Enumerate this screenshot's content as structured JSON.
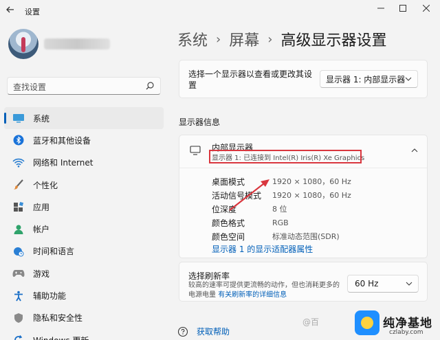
{
  "window": {
    "title": "设置"
  },
  "profile": {},
  "search": {
    "placeholder": "查找设置"
  },
  "sidebar": {
    "items": [
      {
        "label": "系统",
        "icon": "monitor-icon",
        "selected": true
      },
      {
        "label": "蓝牙和其他设备",
        "icon": "bluetooth-icon"
      },
      {
        "label": "网络和 Internet",
        "icon": "wifi-icon"
      },
      {
        "label": "个性化",
        "icon": "brush-icon"
      },
      {
        "label": "应用",
        "icon": "apps-icon"
      },
      {
        "label": "帐户",
        "icon": "person-icon"
      },
      {
        "label": "时间和语言",
        "icon": "globe-clock-icon"
      },
      {
        "label": "游戏",
        "icon": "gamepad-icon"
      },
      {
        "label": "辅助功能",
        "icon": "accessibility-icon"
      },
      {
        "label": "隐私和安全性",
        "icon": "shield-icon"
      },
      {
        "label": "Windows 更新",
        "icon": "update-icon"
      }
    ]
  },
  "breadcrumb": [
    "系统",
    "屏幕",
    "高级显示器设置"
  ],
  "display_select": {
    "label": "选择一个显示器以查看或更改其设置",
    "value": "显示器 1: 内部显示器"
  },
  "section_title": "显示器信息",
  "display_info": {
    "title": "内部显示器",
    "subtitle": "显示器 1: 已连接到 Intel(R) Iris(R) Xe Graphics",
    "rows": [
      {
        "key": "桌面模式",
        "value": "1920 × 1080，60 Hz"
      },
      {
        "key": "活动信号模式",
        "value": "1920 × 1080，60 Hz"
      },
      {
        "key": "位深度",
        "value": "8 位"
      },
      {
        "key": "颜色格式",
        "value": "RGB"
      },
      {
        "key": "颜色空间",
        "value": "标准动态范围(SDR)"
      }
    ],
    "adapter_link": "显示器 1 的显示适配器属性"
  },
  "refresh": {
    "title": "选择刷新率",
    "desc": "较高的速率可提供更流畅的动作，但也消耗更多的电源电量",
    "link": "有关刷新率的详细信息",
    "value": "60 Hz"
  },
  "help": {
    "label": "获取帮助"
  },
  "watermark": {
    "left_text": "@百",
    "title": "纯净基地",
    "url": "czlaby.com"
  },
  "colors": {
    "accent": "#005fb8",
    "highlight_box": "#d9363e",
    "background": "#f3f3f3"
  }
}
